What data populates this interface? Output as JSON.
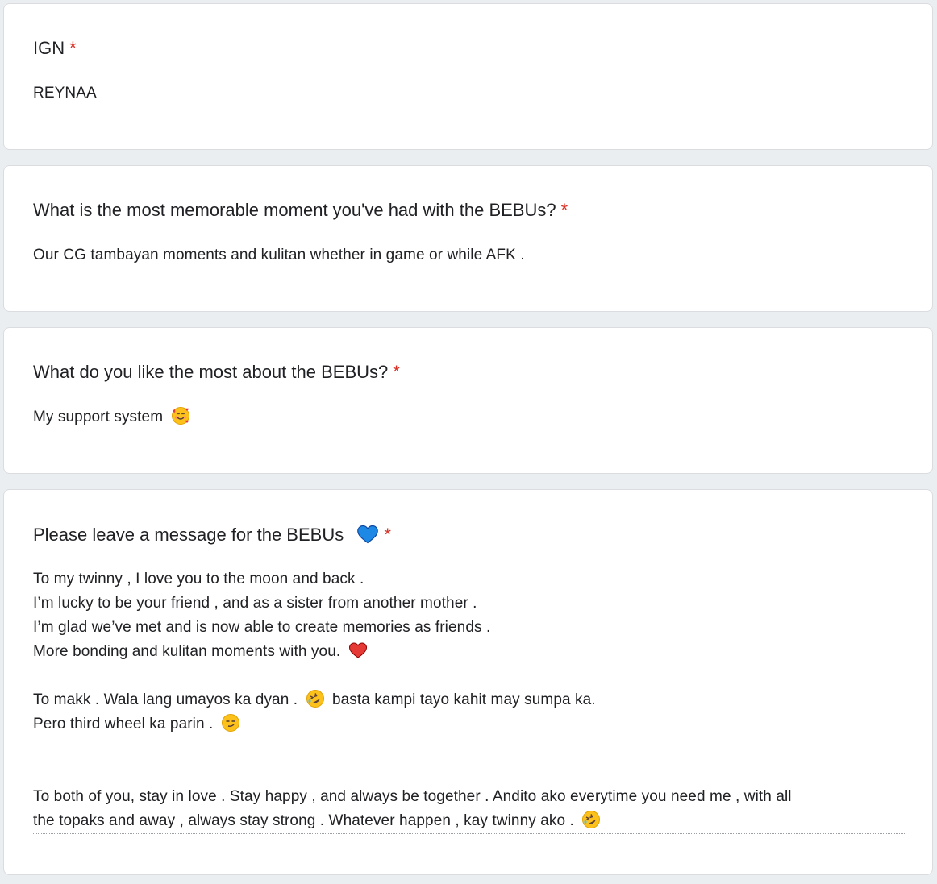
{
  "cards": [
    {
      "question": "IGN",
      "required_mark": "*",
      "answer": [
        "REYNAA"
      ]
    },
    {
      "question": "What is the most memorable moment you've had with the BEBUs?",
      "required_mark": "*",
      "answer": [
        "Our CG tambayan moments and kulitan whether in game or while AFK ."
      ]
    },
    {
      "question": "What do you like the most about the BEBUs?",
      "required_mark": "*",
      "answer": [
        "My support system"
      ]
    },
    {
      "question": "Please leave a message for the BEBUs",
      "required_mark": "*",
      "answer": [
        "To my twinny , I love you to the moon and back .",
        "I’m lucky to be your friend , and as a sister from another mother .",
        "I’m glad we’ve met and is now able to create memories as friends .",
        "More bonding and kulitan moments with you.",
        "",
        "To makk . Wala lang umayos ka dyan .",
        "basta kampi tayo kahit may sumpa ka.",
        "Pero third wheel ka parin .",
        "",
        "",
        "To both of you, stay in love . Stay happy , and always be together . Andito ako everytime you need me , with all",
        "the topaks and away , always stay strong . Whatever happen , kay twinny ako ."
      ]
    }
  ],
  "colors": {
    "background": "#ebeef1",
    "card": "#ffffff",
    "required": "#d93025",
    "text": "#202124"
  },
  "icons": {
    "smiling_hearts": "smiling-face-with-hearts-icon",
    "blue_heart": "blue-heart-icon",
    "red_heart": "red-heart-icon",
    "rofl": "rolling-on-floor-laughing-icon",
    "smirk": "smirking-face-icon"
  }
}
